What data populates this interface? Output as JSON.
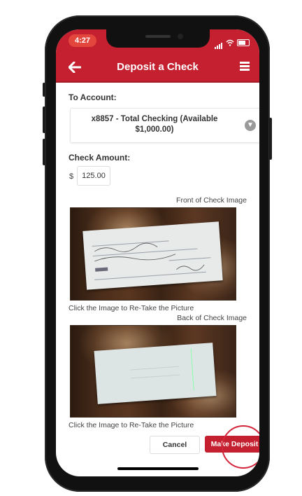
{
  "status_bar": {
    "time": "4:27"
  },
  "header": {
    "title": "Deposit a Check",
    "back_icon": "arrow-left-icon",
    "menu_icon": "hamburger-menu-icon"
  },
  "to_account": {
    "label": "To Account:",
    "selected_line1": "x8857 - Total Checking (Available",
    "selected_line2": "$1,000.00)"
  },
  "check_amount": {
    "label": "Check Amount:",
    "currency": "$",
    "value": "125.00"
  },
  "front_image": {
    "label": "Front of Check Image",
    "caption": "Click the Image to Re-Take the Picture"
  },
  "back_image": {
    "label": "Back of Check Image",
    "caption": "Click the Image to Re-Take the Picture"
  },
  "actions": {
    "cancel": "Cancel",
    "deposit": "Make Deposit"
  },
  "colors": {
    "brand_red": "#c4202f"
  }
}
